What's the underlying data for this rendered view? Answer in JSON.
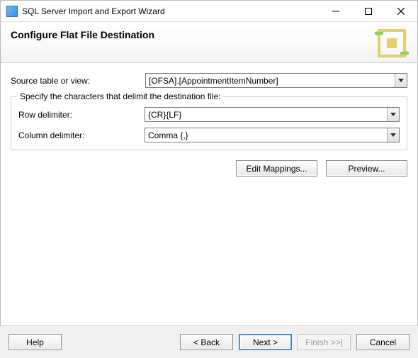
{
  "window": {
    "title": "SQL Server Import and Export Wizard"
  },
  "header": {
    "title": "Configure Flat File Destination"
  },
  "main": {
    "source_label": "Source table or view:",
    "source_value": "[OFSA].[AppointmentItemNumber]",
    "group_legend": "Specify the characters that delimit the destination file:",
    "row_delim_label": "Row delimiter:",
    "row_delim_value": "{CR}{LF}",
    "col_delim_label": "Column delimiter:",
    "col_delim_value": "Comma {,}",
    "edit_mappings": "Edit Mappings...",
    "preview": "Preview..."
  },
  "footer": {
    "help": "Help",
    "back": "< Back",
    "next": "Next >",
    "finish": "Finish >>|",
    "cancel": "Cancel"
  }
}
